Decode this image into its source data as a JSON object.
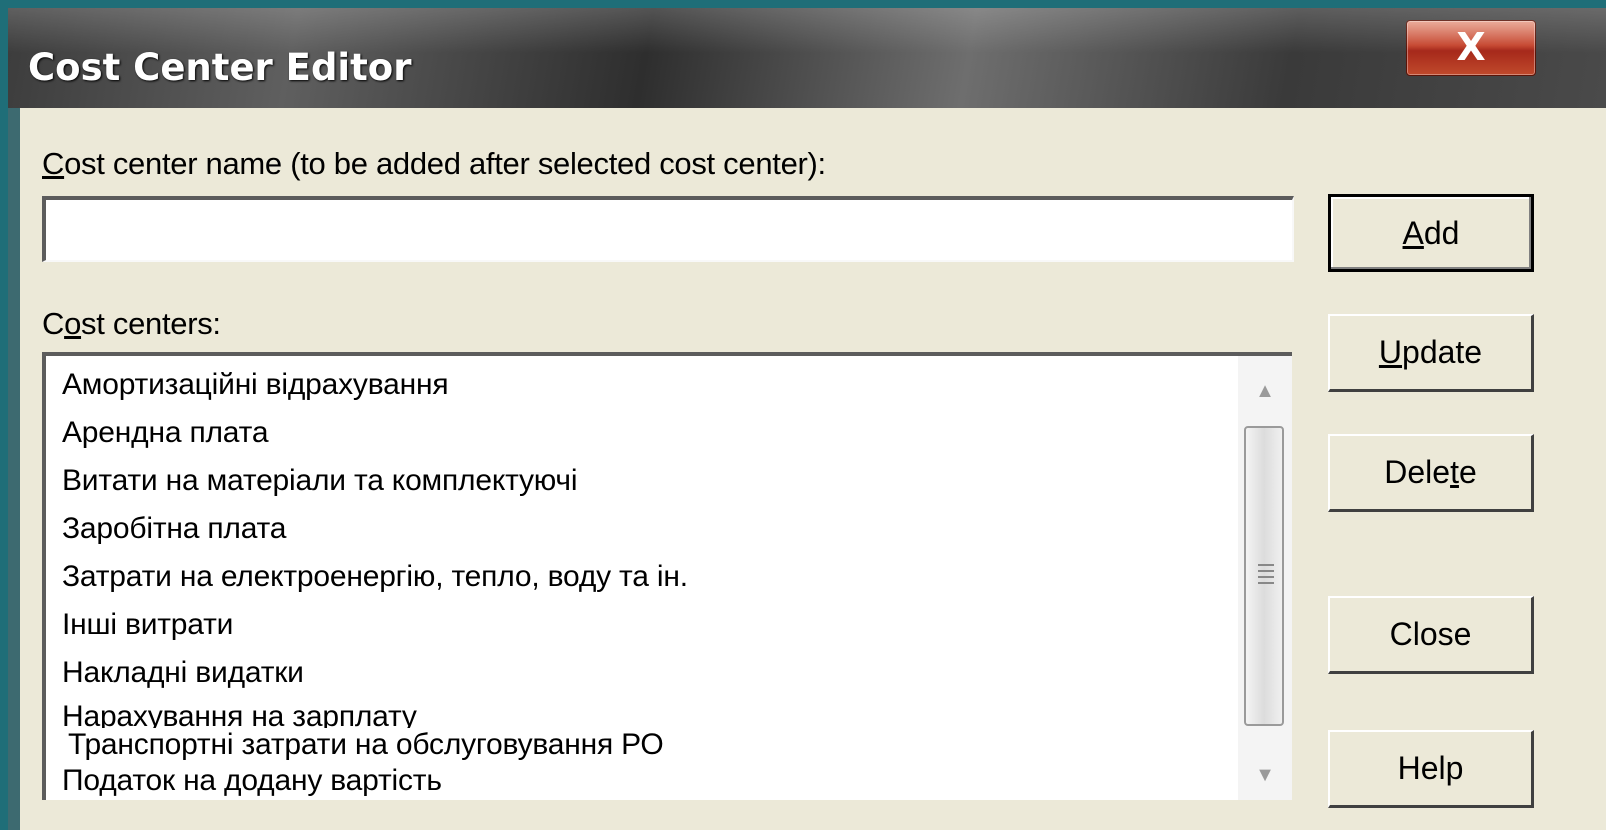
{
  "window": {
    "title": "Cost Center Editor",
    "close_glyph": "X"
  },
  "name_field": {
    "label_accel": "C",
    "label_rest": "ost center name (to be added after selected cost center):",
    "value": "",
    "placeholder": ""
  },
  "list": {
    "label_pre": "C",
    "label_accel": "o",
    "label_rest": "st centers:",
    "items": [
      "Амортизаційні відрахування",
      "Арендна плата",
      "Витати на матеріали та комплектуючі",
      "Заробітна плата",
      "Затрати на електроенергію, тепло, воду та ін.",
      "Інші витрати",
      "Накладні видатки",
      "Нарахування на зарплату",
      "Податок на додану вартість"
    ],
    "overlay_item": "Транспортні затрати на обслуговування РО"
  },
  "buttons": {
    "add": {
      "accel": "A",
      "rest": "dd"
    },
    "update": {
      "accel": "U",
      "rest": "pdate"
    },
    "delete": {
      "pre": "Dele",
      "accel": "t",
      "rest": "e"
    },
    "close": {
      "label": "Close"
    },
    "help": {
      "label": "Help"
    }
  },
  "scrollbar": {
    "up_icon": "▲",
    "down_icon": "▼"
  }
}
